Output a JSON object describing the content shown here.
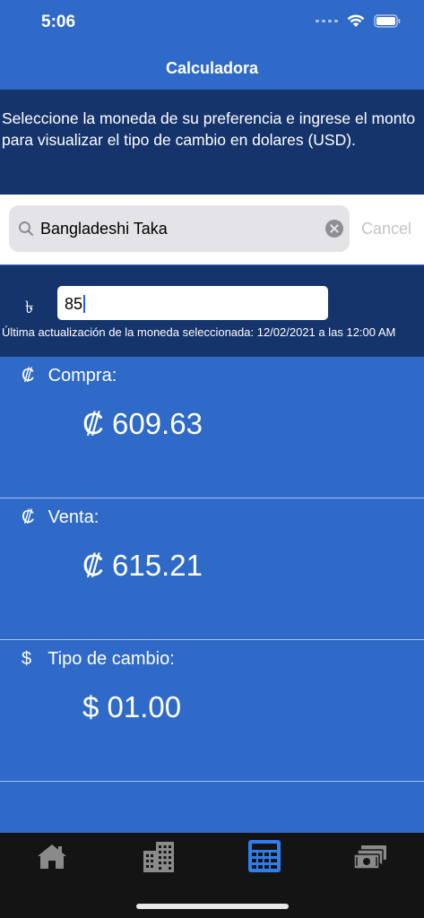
{
  "status_bar": {
    "time": "5:06"
  },
  "nav": {
    "title": "Calculadora"
  },
  "info": {
    "text": "Seleccione la moneda de su preferencia e ingrese el monto para visualizar el tipo de cambio en dolares (USD)."
  },
  "search": {
    "value": "Bangladeshi Taka",
    "cancel_label": "Cancel"
  },
  "amount": {
    "currency_symbol": "৳",
    "value": "85",
    "update_text": "Última actualización de la moneda seleccionada: 12/02/2021 a las 12:00 AM"
  },
  "results": [
    {
      "symbol": "₡",
      "label": "Compra:",
      "value": "₡ 609.63"
    },
    {
      "symbol": "₡",
      "label": "Venta:",
      "value": "₡ 615.21"
    },
    {
      "symbol": "$",
      "label": "Tipo de cambio:",
      "value": "$ 01.00"
    }
  ],
  "tabs": [
    {
      "icon": "home-icon",
      "selected": false
    },
    {
      "icon": "building-icon",
      "selected": false
    },
    {
      "icon": "calculator-icon",
      "selected": true
    },
    {
      "icon": "money-stack-icon",
      "selected": false
    }
  ],
  "colors": {
    "primary_blue": "#2f6ac8",
    "dark_blue": "#15346b",
    "tab_selected": "#2f7ef0",
    "tab_unselected": "#8a8a8a"
  }
}
